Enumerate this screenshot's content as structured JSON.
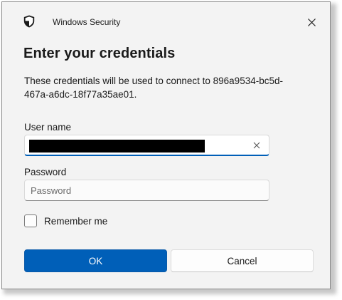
{
  "window": {
    "title": "Windows Security",
    "app_icon": "shield-icon",
    "close_icon": "close-icon"
  },
  "dialog": {
    "heading": "Enter your credentials",
    "description": "These credentials will be used to connect to 896a9534-bc5d-467a-a6dc-18f77a35ae01."
  },
  "username": {
    "label": "User name",
    "value_redacted": true,
    "clear_icon": "clear-icon"
  },
  "password": {
    "label": "Password",
    "placeholder": "Password",
    "value": ""
  },
  "remember": {
    "label": "Remember me",
    "checked": false
  },
  "buttons": {
    "ok": "OK",
    "cancel": "Cancel"
  },
  "colors": {
    "accent": "#005fb8",
    "dialog_bg": "#f3f3f3"
  }
}
